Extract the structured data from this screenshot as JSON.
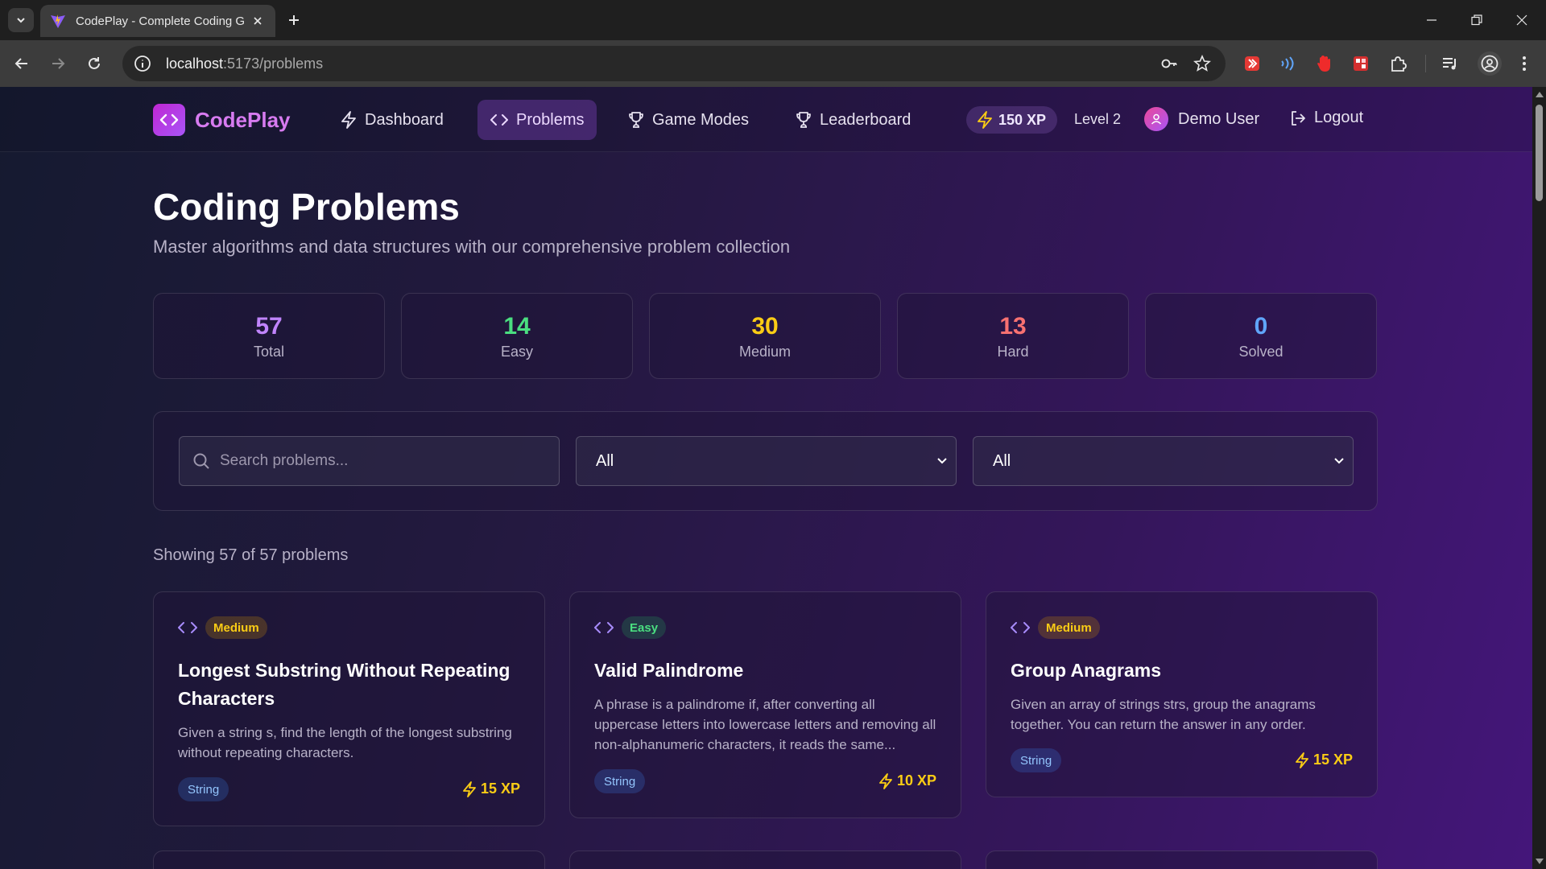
{
  "browser": {
    "tab_title": "CodePlay - Complete Coding G",
    "url_host": "localhost",
    "url_path": ":5173/problems"
  },
  "nav": {
    "logo": "CodePlay",
    "items": [
      {
        "label": "Dashboard",
        "icon": "bolt-icon"
      },
      {
        "label": "Problems",
        "icon": "code-icon"
      },
      {
        "label": "Game Modes",
        "icon": "trophy-icon"
      },
      {
        "label": "Leaderboard",
        "icon": "trophy-icon"
      }
    ],
    "xp": "150 XP",
    "level": "Level 2",
    "user": "Demo User",
    "logout": "Logout"
  },
  "header": {
    "title": "Coding Problems",
    "subtitle": "Master algorithms and data structures with our comprehensive problem collection"
  },
  "stats": [
    {
      "value": "57",
      "label": "Total",
      "color": "#c084fc"
    },
    {
      "value": "14",
      "label": "Easy",
      "color": "#4ade80"
    },
    {
      "value": "30",
      "label": "Medium",
      "color": "#facc15"
    },
    {
      "value": "13",
      "label": "Hard",
      "color": "#f87171"
    },
    {
      "value": "0",
      "label": "Solved",
      "color": "#60a5fa"
    }
  ],
  "filters": {
    "search_placeholder": "Search problems...",
    "difficulty_selected": "All",
    "category_selected": "All"
  },
  "showing": "Showing 57 of 57 problems",
  "problems": [
    {
      "difficulty": "Medium",
      "title": "Longest Substring Without Repeating Characters",
      "description": "Given a string s, find the length of the longest substring without repeating characters.",
      "tag": "String",
      "xp": "15 XP"
    },
    {
      "difficulty": "Easy",
      "title": "Valid Palindrome",
      "description": "A phrase is a palindrome if, after converting all uppercase letters into lowercase letters and removing all non-alphanumeric characters, it reads the same...",
      "tag": "String",
      "xp": "10 XP"
    },
    {
      "difficulty": "Medium",
      "title": "Group Anagrams",
      "description": "Given an array of strings strs, group the anagrams together. You can return the answer in any order.",
      "tag": "String",
      "xp": "15 XP"
    }
  ]
}
